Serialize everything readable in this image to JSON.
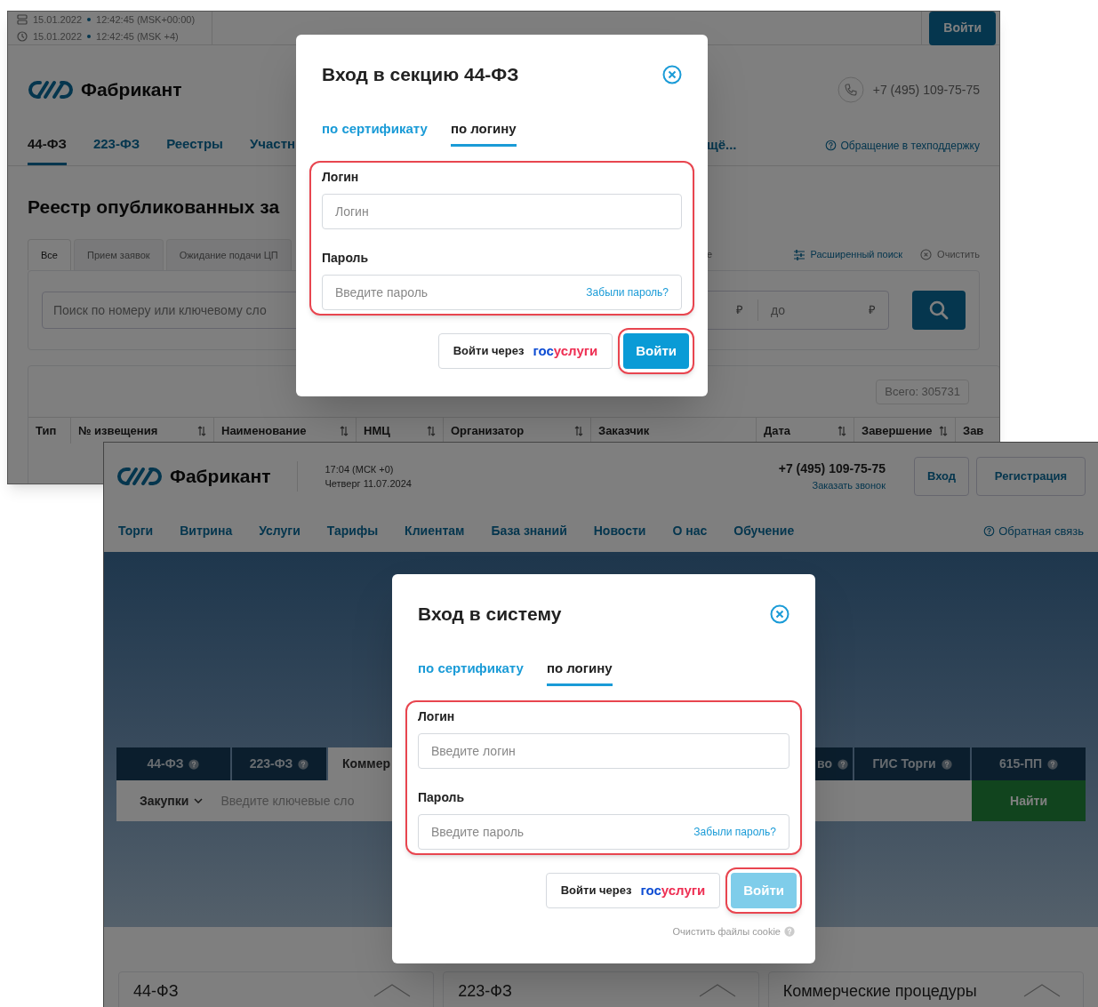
{
  "back_screen": {
    "datetime": [
      {
        "date": "15.01.2022",
        "time": "12:42:45 (MSK+00:00)"
      },
      {
        "date": "15.01.2022",
        "time": "12:42:45 (MSK +4)"
      }
    ],
    "login_button": "Войти",
    "logo": "Фабрикант",
    "phone": "+7 (495) 109-75-75",
    "nav": [
      {
        "label": "44-ФЗ",
        "selected": true
      },
      {
        "label": "223-ФЗ",
        "selected": false
      },
      {
        "label": "Реестры",
        "selected": false
      },
      {
        "label": "Участн",
        "selected": false
      }
    ],
    "nav_more": "щё...",
    "support_link": "Обращение в техподдержку",
    "heading": "Реестр опубликованных за",
    "filter_tabs": [
      {
        "label": "Все",
        "selected": true
      },
      {
        "label": "Прием заявок",
        "selected": false
      },
      {
        "label": "Ожидание подачи ЦП",
        "selected": false
      }
    ],
    "filter_tab_fragment": "е",
    "advanced_search": "Расширенный поиск",
    "clear": "Очистить",
    "search": {
      "placeholder": "Поиск по номеру или ключевому сло"
    },
    "price": {
      "from_currency": "₽",
      "to_placeholder": "до",
      "to_currency": "₽"
    },
    "total": "Всего: 305731",
    "table": {
      "columns": [
        {
          "label": "Тип",
          "sortable": false
        },
        {
          "label": "№ извещения",
          "sortable": true
        },
        {
          "label": "Наименование",
          "sortable": true
        },
        {
          "label": "НМЦ",
          "sortable": true
        },
        {
          "label": "Организатор",
          "sortable": true
        },
        {
          "label": "Заказчик",
          "sortable": false
        },
        {
          "label": "Дата",
          "sortable": true
        },
        {
          "label": "Завершение",
          "sortable": true
        },
        {
          "label": "Зав",
          "sortable": false
        }
      ]
    },
    "modal": {
      "title": "Вход в секцию 44-ФЗ",
      "tabs": [
        {
          "label": "по сертификату",
          "selected": false
        },
        {
          "label": "по логину",
          "selected": true
        }
      ],
      "fields": [
        {
          "label": "Логин",
          "placeholder": "Логин"
        },
        {
          "label": "Пароль",
          "placeholder": "Введите пароль",
          "link": "Забыли пароль?"
        }
      ],
      "gosuslugi_button": {
        "label": "Войти через",
        "logo_parts": [
          "гос",
          "услуги"
        ]
      },
      "submit": {
        "label": "Войти",
        "disabled": false
      }
    }
  },
  "front_screen": {
    "logo": "Фабрикант",
    "time": "17:04 (МСК +0)",
    "date": "Четверг 11.07.2024",
    "phone": "+7 (495) 109-75-75",
    "callback_link": "Заказать звонок",
    "buttons": [
      "Вход",
      "Регистрация"
    ],
    "nav": [
      "Торги",
      "Витрина",
      "Услуги",
      "Тарифы",
      "Клиентам",
      "База знаний",
      "Новости",
      "О нас",
      "Обучение"
    ],
    "feedback_link": "Обратная связь",
    "tabs_left": [
      {
        "label": "44-ФЗ",
        "selected": false,
        "help_icon": true
      },
      {
        "label": "223-ФЗ",
        "selected": false,
        "help_icon": true
      },
      {
        "label": "Коммер",
        "selected": true,
        "help_icon": false
      }
    ],
    "tabs_right": [
      {
        "label": "во",
        "selected": false,
        "help_icon": true
      },
      {
        "label": "ГИС Торги",
        "selected": false,
        "help_icon": true
      },
      {
        "label": "615-ПП",
        "selected": false,
        "help_icon": true
      }
    ],
    "search": {
      "category": "Закупки",
      "placeholder": "Введите ключевые сло",
      "button": "Найти"
    },
    "cards": [
      "44-ФЗ",
      "223-ФЗ",
      "Коммерческие процедуры"
    ],
    "modal": {
      "title": "Вход в систему",
      "tabs": [
        {
          "label": "по сертификату",
          "selected": false
        },
        {
          "label": "по логину",
          "selected": true
        }
      ],
      "fields": [
        {
          "label": "Логин",
          "placeholder": "Введите логин"
        },
        {
          "label": "Пароль",
          "placeholder": "Введите пароль",
          "link": "Забыли пароль?"
        }
      ],
      "gosuslugi_button": {
        "label": "Войти через",
        "logo_parts": [
          "гос",
          "услуги"
        ]
      },
      "submit": {
        "label": "Войти",
        "disabled": true
      },
      "clear_cookies": "Очистить файлы cookie"
    }
  }
}
